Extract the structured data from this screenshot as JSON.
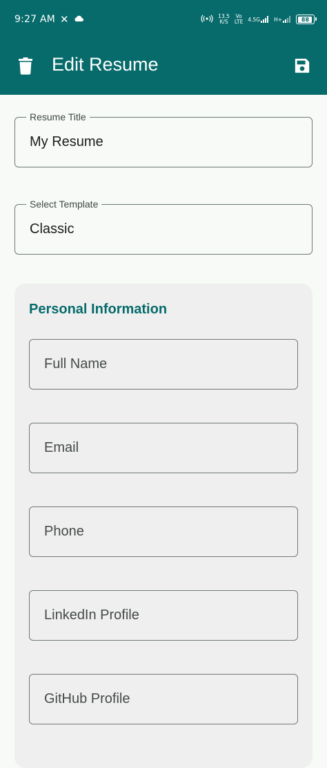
{
  "status_bar": {
    "time": "9:27 AM",
    "network_speed_value": "13.5",
    "network_speed_unit": "K/S",
    "volte_top": "Vo",
    "volte_bottom": "LTE",
    "signal_label": "4.5G",
    "signal2_label": "H+",
    "battery_level": "88"
  },
  "app_bar": {
    "title": "Edit Resume",
    "delete_icon": "trash-icon",
    "save_icon": "floppy-disk-icon"
  },
  "form": {
    "resume_title": {
      "label": "Resume Title",
      "value": "My Resume"
    },
    "template": {
      "label": "Select Template",
      "value": "Classic"
    }
  },
  "personal_info": {
    "title": "Personal Information",
    "fields": {
      "full_name": "Full Name",
      "email": "Email",
      "phone": "Phone",
      "linkedin": "LinkedIn Profile",
      "github": "GitHub Profile"
    }
  },
  "colors": {
    "primary": "#076b6b",
    "background": "#f7faf7",
    "card": "#efefef",
    "outline": "#6f7975"
  }
}
